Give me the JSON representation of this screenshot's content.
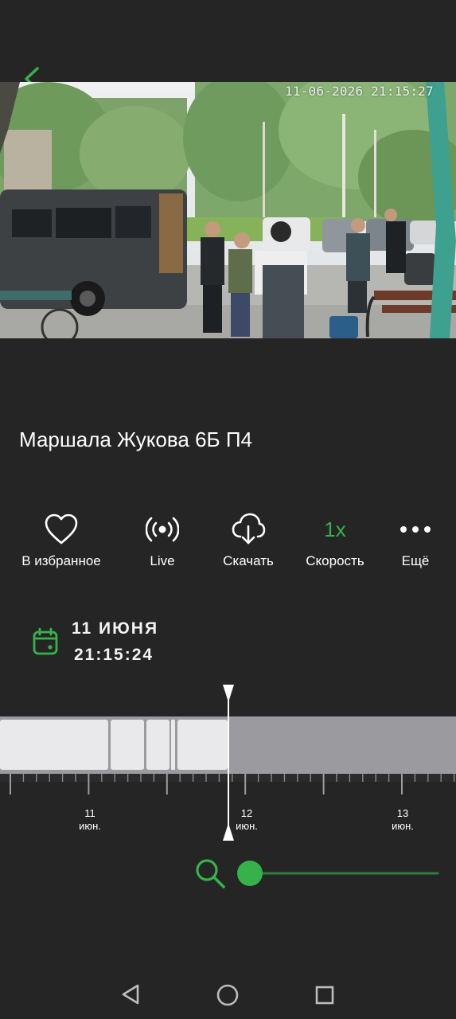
{
  "video": {
    "timestamp": "11-06-2026 21:15:27"
  },
  "camera_title": "Маршала Жукова 6Б П4",
  "actions": [
    {
      "label": "В избранное",
      "icon": "heart-icon"
    },
    {
      "label": "Live",
      "icon": "broadcast-icon"
    },
    {
      "label": "Скачать",
      "icon": "cloud-download-icon"
    },
    {
      "label": "Скорость",
      "icon": "speed",
      "value": "1x"
    },
    {
      "label": "Ещё",
      "icon": "more-dots-icon"
    }
  ],
  "date": {
    "day": "11 ИЮНЯ",
    "time": "21:15:24"
  },
  "timeline": {
    "labels": [
      {
        "day": "11",
        "month": "июн."
      },
      {
        "day": "12",
        "month": "июн."
      },
      {
        "day": "13",
        "month": "июн."
      }
    ]
  },
  "zoom": {
    "level": 0
  },
  "colors": {
    "accent": "#35b34a",
    "background": "#252525",
    "recorded": "#e9e9ec",
    "not_recorded": "#9b9b9f"
  }
}
